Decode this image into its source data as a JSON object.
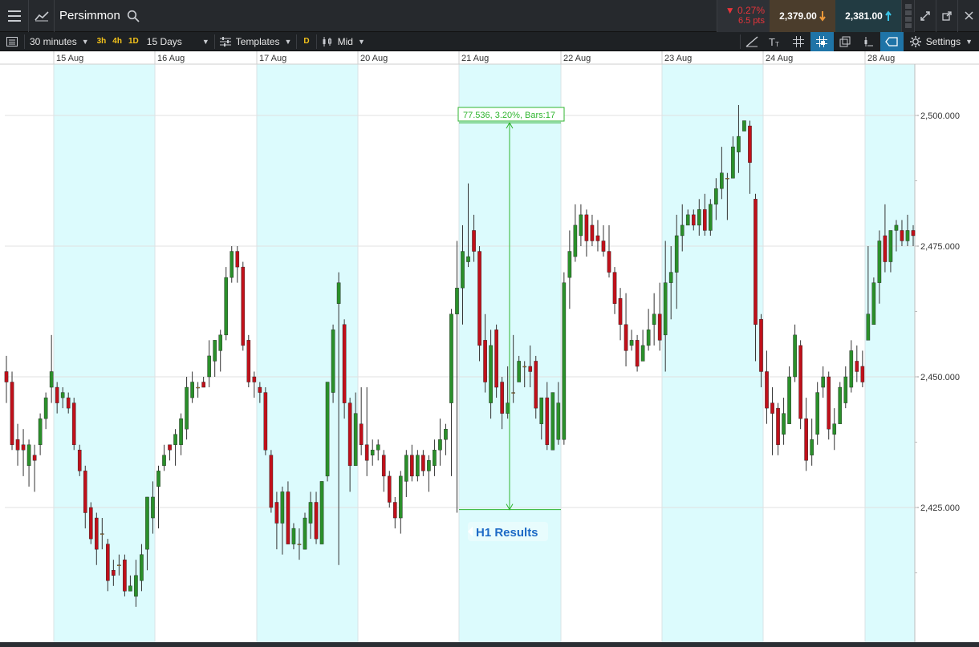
{
  "header": {
    "instrument": "Persimmon",
    "change_pct": "0.27%",
    "change_pts": "6.5 pts",
    "sell_price": "2,379.00",
    "buy_price": "2,381.00"
  },
  "toolbar": {
    "interval": "30 minutes",
    "quick_3h": "3h",
    "quick_4h": "4h",
    "quick_1d": "1D",
    "range": "15 Days",
    "templates": "Templates",
    "d_label": "D",
    "price_mode": "Mid",
    "settings": "Settings"
  },
  "icons": {
    "menu": "hamburger-menu-icon",
    "chart_type": "line-chart-icon",
    "search": "search-icon",
    "down_arrow": "down-arrow-icon",
    "up_arrow": "up-arrow-icon",
    "expand": "expand-icon",
    "popout": "popout-icon",
    "close": "close-icon"
  },
  "colors": {
    "up": "#2a8f2a",
    "down": "#c0101a",
    "doji": "#d99a30",
    "shade": "#dcfbfd",
    "annotation": "#2fb52f",
    "event": "#1d6ac6",
    "active_tool": "#1f74a7"
  },
  "chart_data": {
    "type": "candlestick",
    "y_ticks": [
      "2,500.000",
      "2,475.000",
      "2,450.000",
      "2,425.000"
    ],
    "x_dates": [
      "15 Aug",
      "16 Aug",
      "17 Aug",
      "20 Aug",
      "21 Aug",
      "22 Aug",
      "23 Aug",
      "24 Aug",
      "28 Aug"
    ],
    "shaded_days": [
      "15 Aug",
      "17 Aug",
      "21 Aug",
      "23 Aug",
      "28 Aug"
    ],
    "measure_label": "77.536, 3.20%, Bars:17",
    "measure_from": 2424.6,
    "measure_to": 2498.6,
    "event_label": "H1 Results",
    "ylim": [
      2404,
      2510
    ],
    "candles": [
      [
        2451,
        2449,
        2454,
        2445
      ],
      [
        2449,
        2437,
        2451,
        2436
      ],
      [
        2438,
        2436,
        2441,
        2433
      ],
      [
        2437,
        2436,
        2440,
        2431
      ],
      [
        2433,
        2437,
        2438,
        2429
      ],
      [
        2435,
        2434,
        2437,
        2428
      ],
      [
        2437,
        2442,
        2443,
        2435
      ],
      [
        2442,
        2446,
        2447,
        2440
      ],
      [
        2448,
        2451,
        2458,
        2445
      ],
      [
        2448,
        2445,
        2449,
        2443
      ],
      [
        2446,
        2447,
        2448,
        2444
      ],
      [
        2446,
        2444,
        2447,
        2443
      ],
      [
        2445,
        2437,
        2446,
        2436
      ],
      [
        2436,
        2432,
        2437,
        2431
      ],
      [
        2432,
        2424,
        2433,
        2421
      ],
      [
        2425,
        2419,
        2426,
        2418
      ],
      [
        2423,
        2417,
        2424,
        2414
      ],
      [
        2420,
        2420,
        2423,
        2417
      ],
      [
        2418,
        2411,
        2419,
        2409
      ],
      [
        2413,
        2412,
        2415,
        2410
      ],
      [
        2414,
        2414,
        2416,
        2412
      ],
      [
        2415,
        2409,
        2416,
        2408
      ],
      [
        2409,
        2410,
        2412,
        2409
      ],
      [
        2408,
        2412,
        2415,
        2406
      ],
      [
        2411,
        2416,
        2418,
        2409
      ],
      [
        2417,
        2427,
        2427,
        2413
      ],
      [
        2423,
        2427,
        2430,
        2420
      ],
      [
        2429,
        2432,
        2433,
        2421
      ],
      [
        2433,
        2435,
        2437,
        2432
      ],
      [
        2437,
        2436,
        2437,
        2434
      ],
      [
        2437,
        2439,
        2440,
        2433
      ],
      [
        2437,
        2442,
        2443,
        2435
      ],
      [
        2440,
        2448,
        2450,
        2438
      ],
      [
        2446,
        2449,
        2451,
        2445
      ],
      [
        2448,
        2448,
        2449,
        2446
      ],
      [
        2449,
        2448,
        2450,
        2448
      ],
      [
        2450,
        2454,
        2457,
        2448
      ],
      [
        2453,
        2457,
        2457,
        2450
      ],
      [
        2455,
        2458,
        2459,
        2451
      ],
      [
        2458,
        2469,
        2471,
        2457
      ],
      [
        2469,
        2474,
        2475,
        2468
      ],
      [
        2474,
        2471,
        2475,
        2468
      ],
      [
        2471,
        2456,
        2472,
        2455
      ],
      [
        2457,
        2449,
        2458,
        2448
      ],
      [
        2450,
        2449,
        2451,
        2446
      ],
      [
        2448,
        2447,
        2449,
        2445
      ],
      [
        2447,
        2436,
        2448,
        2435
      ],
      [
        2435,
        2425,
        2436,
        2424
      ],
      [
        2426,
        2422,
        2428,
        2417
      ],
      [
        2422,
        2428,
        2429,
        2416
      ],
      [
        2428,
        2418,
        2430,
        2418
      ],
      [
        2418,
        2421,
        2422,
        2417
      ],
      [
        2418,
        2418,
        2421,
        2415
      ],
      [
        2417,
        2423,
        2424,
        2417
      ],
      [
        2422,
        2426,
        2428,
        2419
      ],
      [
        2426,
        2419,
        2428,
        2418
      ],
      [
        2418,
        2430,
        2430,
        2418
      ],
      [
        2431,
        2449,
        2449,
        2430
      ],
      [
        2447,
        2459,
        2460,
        2445
      ],
      [
        2464,
        2468,
        2470,
        2414
      ],
      [
        2460,
        2445,
        2461,
        2442
      ],
      [
        2445,
        2433,
        2446,
        2428
      ],
      [
        2433,
        2443,
        2447,
        2433
      ],
      [
        2441,
        2437,
        2448,
        2435
      ],
      [
        2437,
        2434,
        2448,
        2431
      ],
      [
        2435,
        2436,
        2438,
        2433
      ],
      [
        2436,
        2437,
        2438,
        2434
      ],
      [
        2435,
        2431,
        2436,
        2428
      ],
      [
        2431,
        2426,
        2432,
        2425
      ],
      [
        2426,
        2423,
        2427,
        2421
      ],
      [
        2423,
        2431,
        2432,
        2420
      ],
      [
        2430,
        2435,
        2436,
        2427
      ],
      [
        2435,
        2431,
        2437,
        2430
      ],
      [
        2431,
        2435,
        2436,
        2430
      ],
      [
        2435,
        2432,
        2436,
        2431
      ],
      [
        2432,
        2434,
        2435,
        2428
      ],
      [
        2433,
        2436,
        2438,
        2431
      ],
      [
        2436,
        2438,
        2442,
        2433
      ],
      [
        2438,
        2440,
        2441,
        2435
      ],
      [
        2445,
        2462,
        2463,
        2431
      ],
      [
        2462,
        2467,
        2476,
        2424
      ],
      [
        2467,
        2474,
        2479,
        2460
      ],
      [
        2472,
        2473,
        2487,
        2471
      ],
      [
        2478,
        2474,
        2481,
        2472
      ],
      [
        2474,
        2456,
        2475,
        2453
      ],
      [
        2457,
        2449,
        2462,
        2447
      ],
      [
        2445,
        2456,
        2459,
        2442
      ],
      [
        2459,
        2448,
        2460,
        2446
      ],
      [
        2449,
        2443,
        2450,
        2440
      ],
      [
        2443,
        2445,
        2452,
        2442
      ],
      [
        2447,
        2447,
        2458,
        2445
      ],
      [
        2449,
        2453,
        2454,
        2450
      ],
      [
        2452,
        2452,
        2453,
        2448
      ],
      [
        2452,
        2451,
        2456,
        2448
      ],
      [
        2453,
        2444,
        2454,
        2442
      ],
      [
        2441,
        2446,
        2446,
        2438
      ],
      [
        2446,
        2437,
        2449,
        2436
      ],
      [
        2436,
        2447,
        2447,
        2437
      ],
      [
        2438,
        2445,
        2449,
        2437
      ],
      [
        2438,
        2468,
        2470,
        2437
      ],
      [
        2469,
        2474,
        2478,
        2463
      ],
      [
        2473,
        2479,
        2483,
        2472
      ],
      [
        2477,
        2481,
        2483,
        2475
      ],
      [
        2481,
        2476,
        2482,
        2473
      ],
      [
        2479,
        2476,
        2481,
        2475
      ],
      [
        2477,
        2476,
        2480,
        2474
      ],
      [
        2476,
        2474,
        2479,
        2473
      ],
      [
        2474,
        2470,
        2479,
        2469
      ],
      [
        2470,
        2464,
        2471,
        2462
      ],
      [
        2465,
        2460,
        2467,
        2457
      ],
      [
        2460,
        2455,
        2466,
        2452
      ],
      [
        2456,
        2457,
        2459,
        2455
      ],
      [
        2457,
        2452,
        2458,
        2451
      ],
      [
        2453,
        2456,
        2459,
        2454
      ],
      [
        2456,
        2459,
        2463,
        2455
      ],
      [
        2460,
        2462,
        2466,
        2456
      ],
      [
        2462,
        2457,
        2468,
        2455
      ],
      [
        2458,
        2468,
        2476,
        2451
      ],
      [
        2468,
        2470,
        2475,
        2461
      ],
      [
        2470,
        2477,
        2481,
        2463
      ],
      [
        2477,
        2479,
        2483,
        2474
      ],
      [
        2479,
        2481,
        2482,
        2479
      ],
      [
        2481,
        2479,
        2482,
        2478
      ],
      [
        2479,
        2482,
        2484,
        2477
      ],
      [
        2482,
        2478,
        2485,
        2477
      ],
      [
        2478,
        2483,
        2484,
        2477
      ],
      [
        2483,
        2486,
        2488,
        2480
      ],
      [
        2486,
        2489,
        2494,
        2484
      ],
      [
        2488,
        2488,
        2489,
        2480
      ],
      [
        2488,
        2494,
        2496,
        2489
      ],
      [
        2493,
        2496,
        2502,
        2489
      ],
      [
        2497,
        2499,
        2499,
        2498
      ],
      [
        2498,
        2491,
        2499,
        2485
      ],
      [
        2484,
        2460,
        2485,
        2453
      ],
      [
        2461,
        2451,
        2462,
        2448
      ],
      [
        2451,
        2444,
        2455,
        2441
      ],
      [
        2445,
        2443,
        2448,
        2435
      ],
      [
        2444,
        2437,
        2445,
        2435
      ],
      [
        2439,
        2443,
        2446,
        2437
      ],
      [
        2441,
        2450,
        2452,
        2441
      ],
      [
        2450,
        2458,
        2460,
        2449
      ],
      [
        2456,
        2442,
        2457,
        2440
      ],
      [
        2442,
        2434,
        2446,
        2432
      ],
      [
        2435,
        2438,
        2442,
        2433
      ],
      [
        2439,
        2447,
        2449,
        2437
      ],
      [
        2448,
        2450,
        2452,
        2446
      ],
      [
        2450,
        2440,
        2451,
        2438
      ],
      [
        2439,
        2441,
        2444,
        2436
      ],
      [
        2441,
        2448,
        2449,
        2442
      ],
      [
        2445,
        2450,
        2452,
        2444
      ],
      [
        2448,
        2455,
        2457,
        2447
      ],
      [
        2453,
        2451,
        2456,
        2449
      ],
      [
        2452,
        2449,
        2455,
        2448
      ],
      [
        2457,
        2462,
        2475,
        2457
      ],
      [
        2460,
        2468,
        2469,
        2466
      ],
      [
        2468,
        2476,
        2478,
        2464
      ],
      [
        2477,
        2472,
        2483,
        2470
      ],
      [
        2472,
        2478,
        2478,
        2470
      ],
      [
        2478,
        2479,
        2480,
        2474
      ],
      [
        2478,
        2476,
        2480,
        2475
      ],
      [
        2476,
        2478,
        2481,
        2475
      ],
      [
        2478,
        2477,
        2479,
        2475
      ]
    ]
  }
}
